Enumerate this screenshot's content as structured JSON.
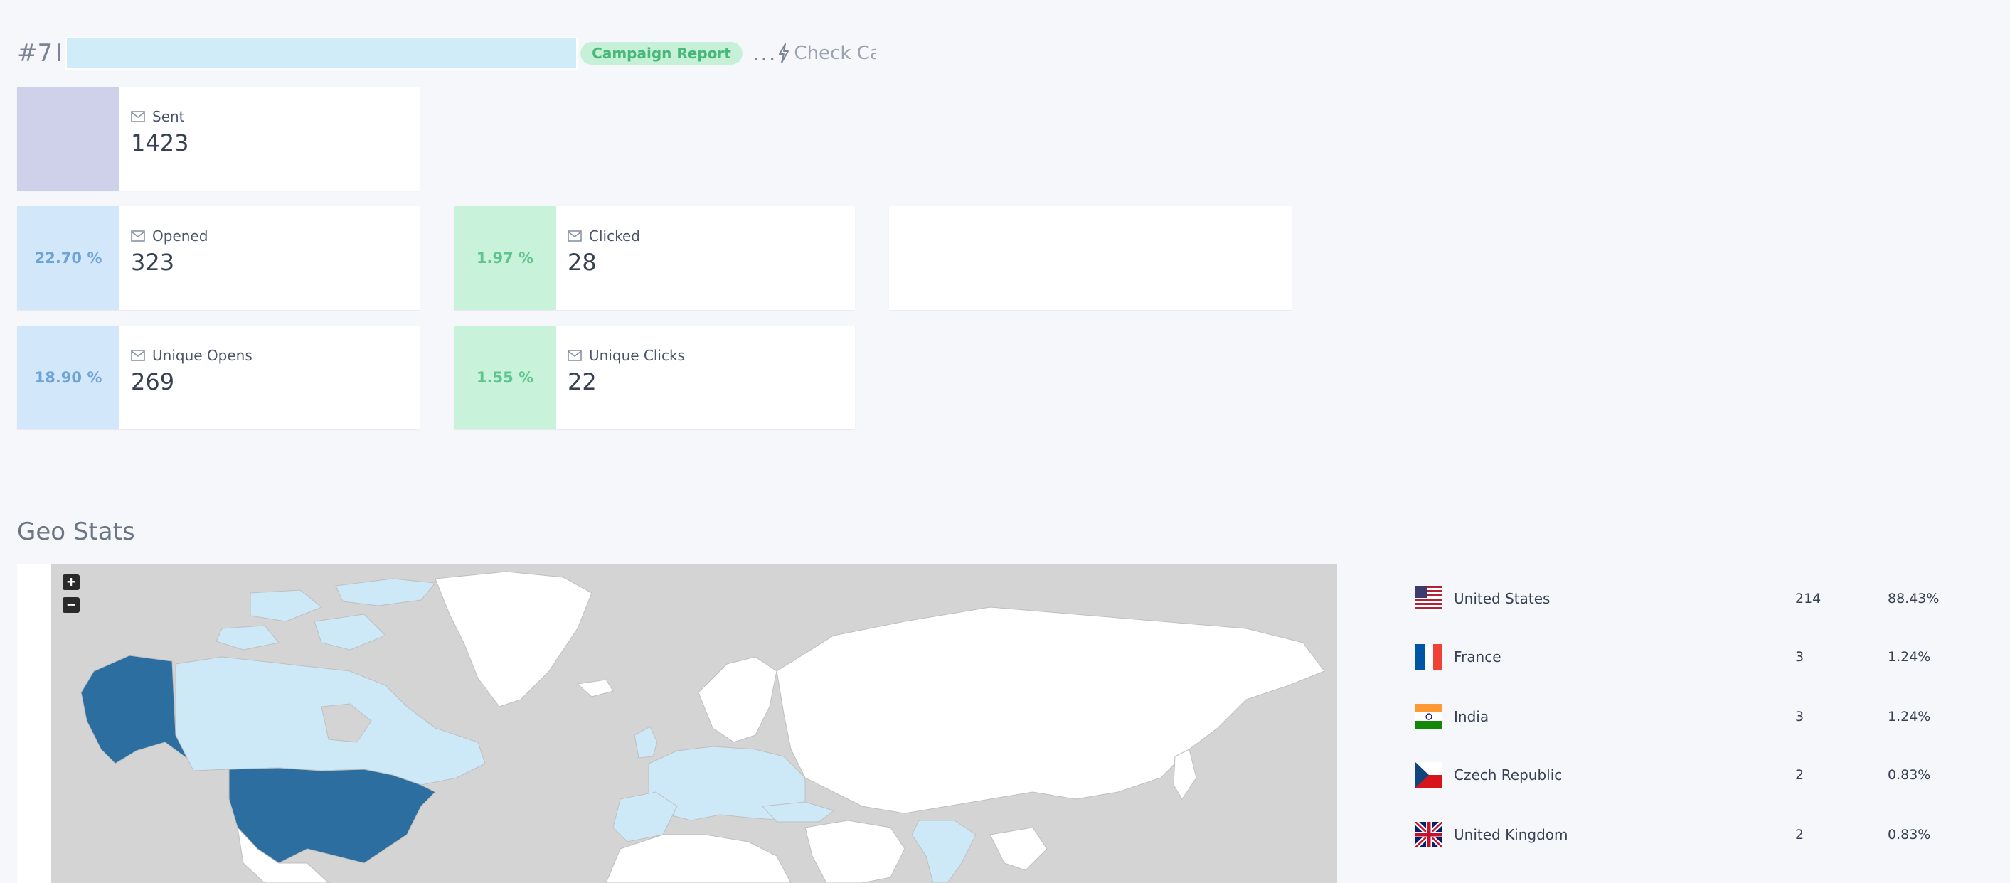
{
  "header": {
    "number": "#7",
    "cursor": "I",
    "badge": "Campaign Report",
    "ellipsis": "...",
    "check_link": "Check Campaign"
  },
  "stats": {
    "sent": {
      "label": "Sent",
      "value": "1423"
    },
    "opened": {
      "label": "Opened",
      "value": "323",
      "percent": "22.70 %"
    },
    "clicked": {
      "label": "Clicked",
      "value": "28",
      "percent": "1.97 %"
    },
    "unique_opens": {
      "label": "Unique Opens",
      "value": "269",
      "percent": "18.90 %"
    },
    "unique_clicks": {
      "label": "Unique Clicks",
      "value": "22",
      "percent": "1.55 %"
    }
  },
  "geo": {
    "title": "Geo Stats",
    "zoom_in": "+",
    "zoom_out": "−",
    "countries": [
      {
        "name": "United States",
        "count": "214",
        "percent": "88.43%",
        "flag": "us-flag"
      },
      {
        "name": "France",
        "count": "3",
        "percent": "1.24%",
        "flag": "fr-flag"
      },
      {
        "name": "India",
        "count": "3",
        "percent": "1.24%",
        "flag": "in-flag"
      },
      {
        "name": "Czech Republic",
        "count": "2",
        "percent": "0.83%",
        "flag": "cz-flag"
      },
      {
        "name": "United Kingdom",
        "count": "2",
        "percent": "0.83%",
        "flag": "gb-flag"
      }
    ]
  },
  "colors": {
    "map_ocean": "#d4d4d4",
    "map_land": "#ffffff",
    "map_light": "#cde9f8",
    "map_dark": "#2d6ea0",
    "accent_blue": "#6ea3d6",
    "accent_green": "#5fc48e"
  }
}
